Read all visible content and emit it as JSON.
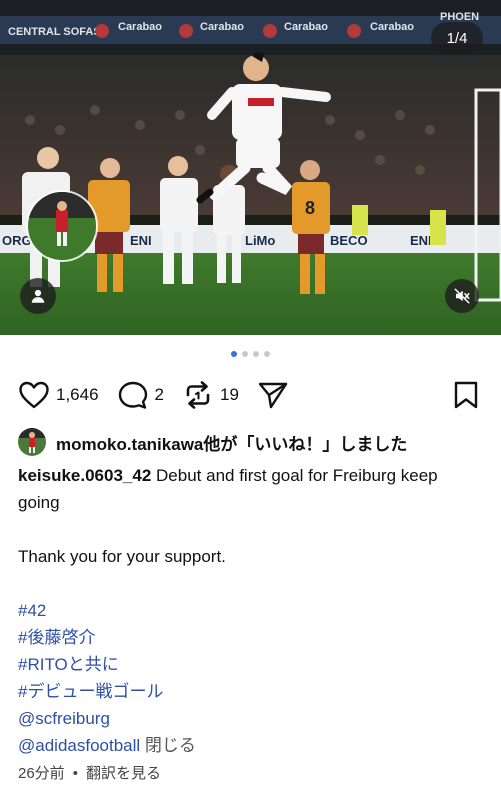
{
  "media": {
    "counter": "1/4",
    "user_tag_icon": "person-icon",
    "mute_icon": "speaker-muted-icon",
    "scene_description_hidden": ""
  },
  "carousel": {
    "dot_count": 4,
    "active_index": 0
  },
  "actions": {
    "likes": "1,646",
    "comments": "2",
    "reposts": "19",
    "like_icon": "heart-icon",
    "comment_icon": "comment-icon",
    "repost_icon": "repost-icon",
    "share_icon": "send-icon",
    "save_icon": "bookmark-icon"
  },
  "likes_line": {
    "text": "momoko.tanikawa他が「いいね！」しました"
  },
  "caption": {
    "username": "keisuke.0603_42",
    "text": "Debut and first goal for Freiburg keep going",
    "thanks": "Thank you for your support.",
    "hashtags": [
      "#42",
      "#後藤啓介",
      "#RITOと共に",
      "#デビュー戦ゴール"
    ],
    "mentions": [
      "@scfreiburg",
      "@adidasfootball"
    ],
    "close": "閉じる"
  },
  "meta": {
    "time": "26分前",
    "translate": "翻訳を見る"
  },
  "colors": {
    "link": "#2e4fa8",
    "active_dot": "#3b6fd9"
  }
}
